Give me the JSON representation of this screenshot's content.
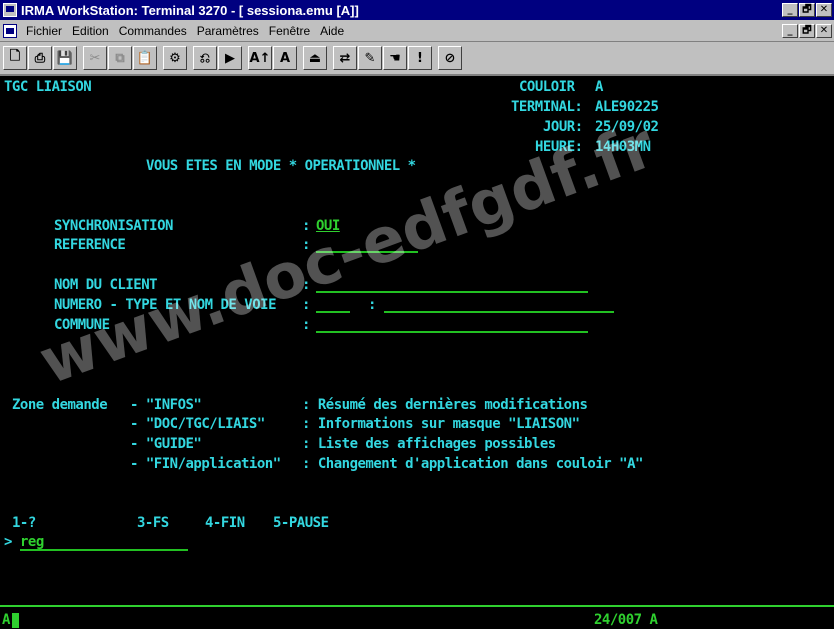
{
  "window": {
    "title": "IRMA WorkStation: Terminal 3270   - [ sessiona.emu [A]]",
    "buttons": [
      "_",
      "🗗",
      "✕"
    ]
  },
  "menu": {
    "items": [
      "Fichier",
      "Edition",
      "Commandes",
      "Paramètres",
      "Fenêtre",
      "Aide"
    ],
    "doc_buttons": [
      "_",
      "🗗",
      "✕"
    ]
  },
  "toolbar": {
    "buttons": [
      {
        "name": "new-icon",
        "glyph": "🗋"
      },
      {
        "name": "print-icon",
        "glyph": "⎙"
      },
      {
        "name": "save-icon",
        "glyph": "💾"
      },
      {
        "name": "cut-icon",
        "glyph": "✂"
      },
      {
        "name": "copy-icon",
        "glyph": "⧉"
      },
      {
        "name": "paste-icon",
        "glyph": "📋"
      },
      {
        "name": "macro-icon",
        "glyph": "⚙"
      },
      {
        "name": "record-icon",
        "glyph": "⎌"
      },
      {
        "name": "playback-icon",
        "glyph": "▶"
      },
      {
        "name": "font-larger-icon",
        "glyph": "A↑"
      },
      {
        "name": "font-icon",
        "glyph": "A"
      },
      {
        "name": "connect-icon",
        "glyph": "⏏"
      },
      {
        "name": "transfer-icon",
        "glyph": "⇄"
      },
      {
        "name": "pencil-icon",
        "glyph": "✎"
      },
      {
        "name": "hand-icon",
        "glyph": "☚"
      },
      {
        "name": "alert-icon",
        "glyph": "!"
      },
      {
        "name": "compass-icon",
        "glyph": "⊘"
      }
    ]
  },
  "screen": {
    "app": "TGC LIAISON",
    "couloir_label": "COULOIR",
    "couloir_value": "A",
    "terminal_label": "TERMINAL:",
    "terminal_value": "ALE90225",
    "jour_label": "JOUR:",
    "jour_value": "25/09/02",
    "heure_label": "HEURE:",
    "heure_value": "14H03MN",
    "mode": "VOUS ETES EN MODE * OPERATIONNEL *",
    "fields": {
      "synchro_label": "SYNCHRONISATION",
      "synchro_value": "OUI",
      "reference_label": "REFERENCE",
      "client_label": "NOM DU CLIENT",
      "voie_label": "NUMERO - TYPE ET NOM DE VOIE",
      "commune_label": "COMMUNE",
      "colon": ":"
    },
    "zone": {
      "label": "Zone demande",
      "lines": [
        {
          "cmd": "- \"INFOS\"",
          "desc": ": Résumé des dernières modifications"
        },
        {
          "cmd": "- \"DOC/TGC/LIAIS\"",
          "desc": ": Informations sur masque \"LIAISON\""
        },
        {
          "cmd": "- \"GUIDE\"",
          "desc": ": Liste des affichages possibles"
        },
        {
          "cmd": "- \"FIN/application\"",
          "desc": ": Changement d'application dans couloir \"A\""
        }
      ]
    },
    "pf_keys": [
      "1-?",
      "3-FS",
      "4-FIN",
      "5-PAUSE"
    ],
    "prompt": ">",
    "command_value": "reg"
  },
  "status": {
    "left": "A",
    "position": "24/007 A"
  },
  "watermark": "www.doc-edfgdf.fr"
}
